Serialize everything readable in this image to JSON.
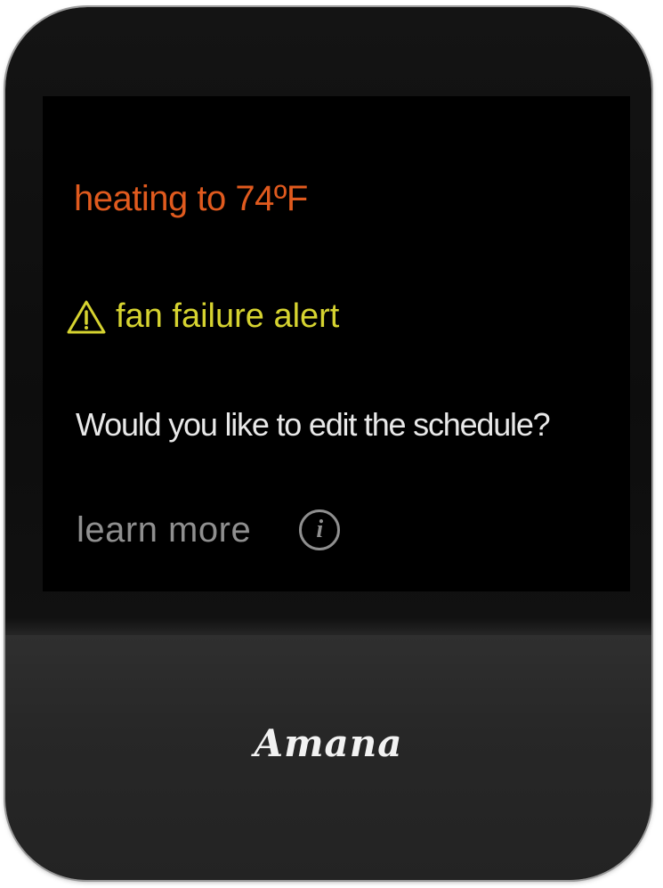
{
  "screen": {
    "status": "heating to 74ºF",
    "alert": {
      "icon": "warning-triangle-icon",
      "text": "fan failure alert",
      "color": "#d6d330"
    },
    "prompt": "Would you like to edit the schedule?",
    "learn_more": {
      "label": "learn more",
      "icon": "info-icon",
      "icon_glyph": "i"
    }
  },
  "device": {
    "brand": "Amana"
  },
  "colors": {
    "heating": "#e05a1e",
    "alert": "#d6d330",
    "prompt": "#e8e8e8",
    "muted": "#8f8f8f",
    "bezel": "#141414",
    "lower_panel": "#2a2a2a"
  }
}
